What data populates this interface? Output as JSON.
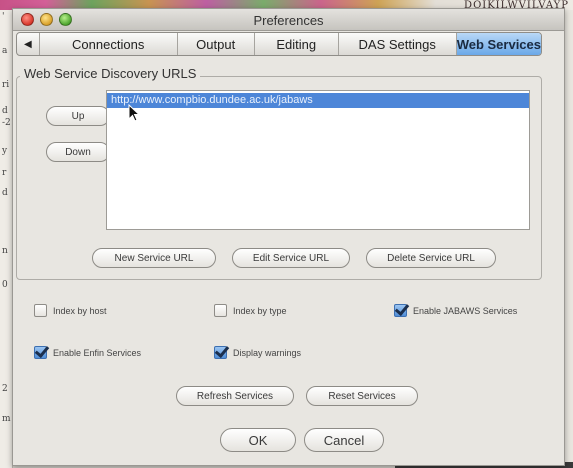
{
  "background": {
    "sequence_text": "DQIKILWVILVAYP",
    "side_marks": [
      "'",
      "a",
      "ri",
      "d",
      "-2",
      "y",
      "r",
      "d",
      "n",
      "0",
      "2",
      "m"
    ]
  },
  "window": {
    "title": "Preferences"
  },
  "tabs": [
    {
      "label": "Connections",
      "active": false
    },
    {
      "label": "Output",
      "active": false
    },
    {
      "label": "Editing",
      "active": false
    },
    {
      "label": "DAS Settings",
      "active": false
    },
    {
      "label": "Web Services",
      "active": true
    }
  ],
  "group": {
    "label": "Web Service Discovery URLS",
    "up_label": "Up",
    "down_label": "Down",
    "urls": [
      "http://www.compbio.dundee.ac.uk/jabaws"
    ],
    "new_label": "New Service URL",
    "edit_label": "Edit Service URL",
    "delete_label": "Delete Service URL"
  },
  "options": [
    {
      "label": "Index by host",
      "checked": false
    },
    {
      "label": "Index by type",
      "checked": false
    },
    {
      "label": "Enable JABAWS Services",
      "checked": true
    },
    {
      "label": "Enable Enfin Services",
      "checked": true
    },
    {
      "label": "Display warnings",
      "checked": true
    }
  ],
  "actions": {
    "refresh_label": "Refresh Services",
    "reset_label": "Reset Services",
    "ok_label": "OK",
    "cancel_label": "Cancel"
  },
  "colors": {
    "selection": "#4d86d8",
    "active_tab": "#6aa8e8",
    "check_blue": "#4f8ed8"
  }
}
